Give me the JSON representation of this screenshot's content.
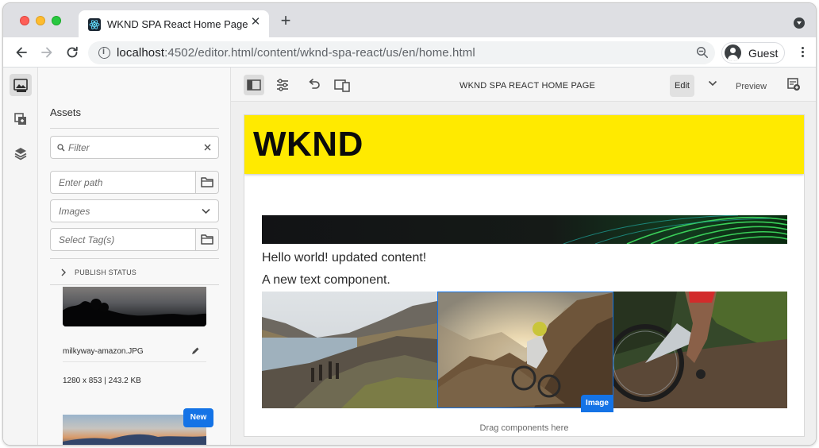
{
  "browser": {
    "tab_title": "WKND SPA React Home Page",
    "close_label": "✕",
    "new_tab_label": "+",
    "url_host": "localhost",
    "url_rest": ":4502/editor.html/content/wknd-spa-react/us/en/home.html",
    "profile_label": "Guest"
  },
  "assets_panel": {
    "title": "Assets",
    "filter_placeholder": "Filter",
    "path_placeholder": "Enter path",
    "type_select": "Images",
    "tags_placeholder": "Select Tag(s)",
    "publish_status": "PUBLISH STATUS",
    "asset_name": "milkyway-amazon.JPG",
    "asset_meta": "1280 x 853 | 243.2 KB",
    "new_badge": "New"
  },
  "editor": {
    "page_title": "WKND SPA REACT HOME PAGE",
    "edit_label": "Edit",
    "preview_label": "Preview"
  },
  "page": {
    "logo": "WKND",
    "text_1": "Hello world! updated content!",
    "text_2": "A new text component.",
    "image_badge": "Image",
    "drag_hint": "Drag components here"
  },
  "colors": {
    "accent": "#1473e6",
    "wknd_yellow": "#ffea00"
  }
}
